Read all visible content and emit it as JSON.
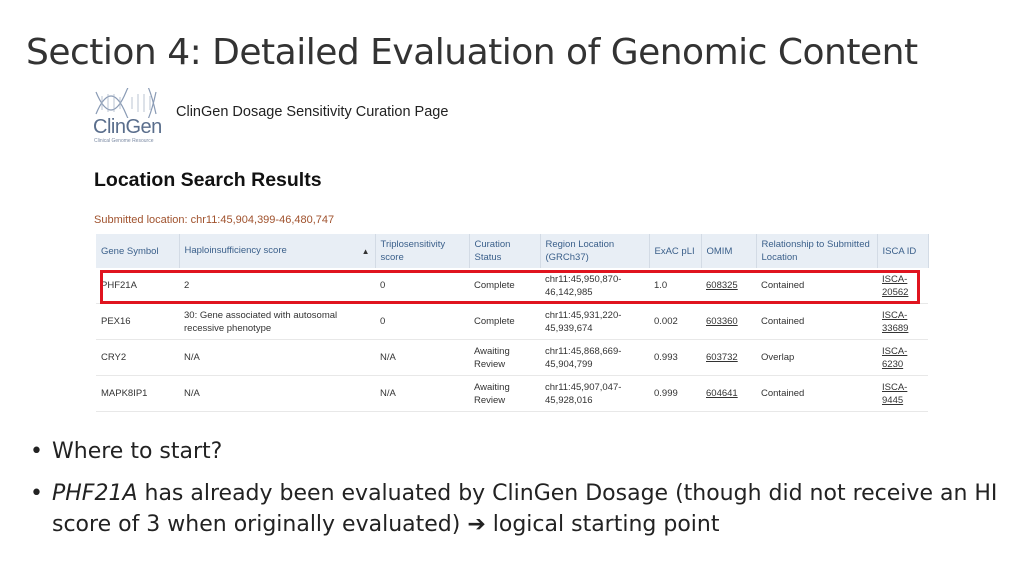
{
  "slide": {
    "title": "Section 4: Detailed Evaluation of Genomic Content"
  },
  "screenshot": {
    "logo": {
      "name": "ClinGen",
      "tagline": "Clinical Genome Resource"
    },
    "page_heading": "ClinGen Dosage Sensitivity Curation Page",
    "results_heading": "Location Search Results",
    "submitted_location": "Submitted location: chr11:45,904,399-46,480,747",
    "table": {
      "columns": [
        "Gene Symbol",
        "Haploinsufficiency score",
        "Triplosensitivity score",
        "Curation Status",
        "Region Location (GRCh37)",
        "ExAC pLI",
        "OMIM",
        "Relationship to Submitted Location",
        "ISCA ID"
      ],
      "rows": [
        {
          "gene": "PHF21A",
          "hi": "2",
          "ts": "0",
          "status": "Complete",
          "region": "chr11:45,950,870-46,142,985",
          "pli": "1.0",
          "omim": "608325",
          "relationship": "Contained",
          "isca": "ISCA-20562"
        },
        {
          "gene": "PEX16",
          "hi": "30: Gene associated with autosomal recessive phenotype",
          "ts": "0",
          "status": "Complete",
          "region": "chr11:45,931,220-45,939,674",
          "pli": "0.002",
          "omim": "603360",
          "relationship": "Contained",
          "isca": "ISCA-33689"
        },
        {
          "gene": "CRY2",
          "hi": "N/A",
          "ts": "N/A",
          "status": "Awaiting Review",
          "region": "chr11:45,868,669-45,904,799",
          "pli": "0.993",
          "omim": "603732",
          "relationship": "Overlap",
          "isca": "ISCA-6230"
        },
        {
          "gene": "MAPK8IP1",
          "hi": "N/A",
          "ts": "N/A",
          "status": "Awaiting Review",
          "region": "chr11:45,907,047-45,928,016",
          "pli": "0.999",
          "omim": "604641",
          "relationship": "Contained",
          "isca": "ISCA-9445"
        }
      ]
    },
    "highlighted_row": "PHF21A"
  },
  "bullets": {
    "b1": "Where to start?",
    "b2_gene": "PHF21A",
    "b2_text": " has already been evaluated by ClinGen Dosage (though did not receive an HI score of 3 when originally evaluated) ",
    "b2_end": " logical starting point",
    "arrow": "➔"
  },
  "colors": {
    "highlight_border": "#e0141f",
    "header_bg": "#e8eef5",
    "header_text": "#3a5f8a",
    "link": "#1a4d9e",
    "submitted_text": "#a0522d"
  }
}
